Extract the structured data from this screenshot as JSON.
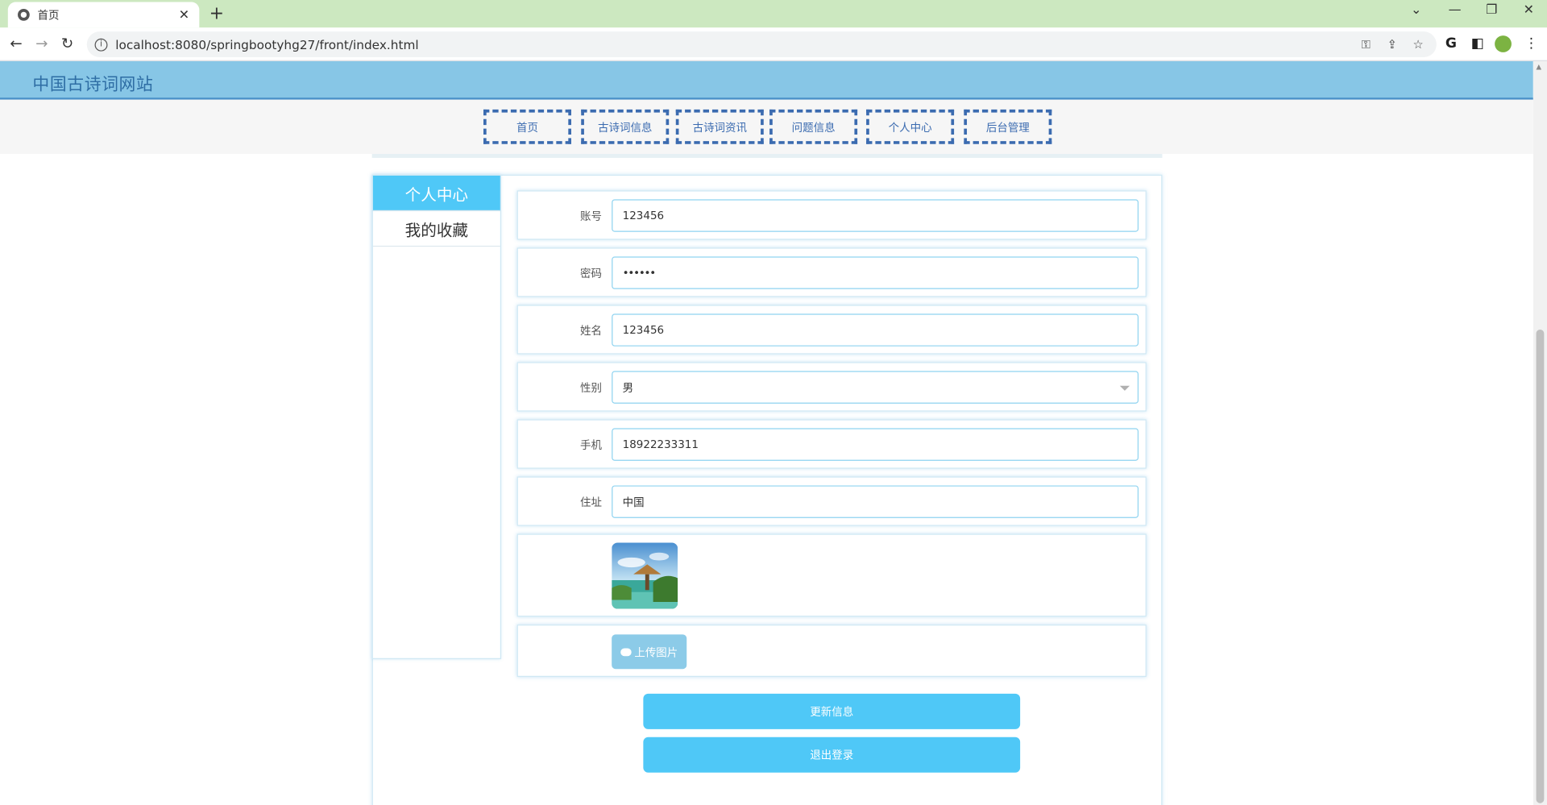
{
  "browser": {
    "tab_title": "首页",
    "tab_close": "✕",
    "new_tab": "+",
    "url": "localhost:8080/springbootyhg27/front/index.html",
    "back": "←",
    "forward": "→",
    "reload": "↻",
    "win_dropdown": "⌄",
    "win_minimize": "—",
    "win_restore": "❐",
    "win_close": "✕"
  },
  "site": {
    "title": "中国古诗词网站"
  },
  "nav": {
    "items": [
      "首页",
      "古诗词信息",
      "古诗词资讯",
      "问题信息",
      "个人中心",
      "后台管理"
    ]
  },
  "sidebar": {
    "items": [
      {
        "label": "个人中心",
        "active": true
      },
      {
        "label": "我的收藏",
        "active": false
      }
    ]
  },
  "form": {
    "account_label": "账号",
    "account_value": "123456",
    "password_label": "密码",
    "password_value": "••••••",
    "name_label": "姓名",
    "name_value": "123456",
    "gender_label": "性别",
    "gender_value": "男",
    "phone_label": "手机",
    "phone_value": "18922233311",
    "address_label": "住址",
    "address_value": "中国",
    "upload_label": "上传图片"
  },
  "actions": {
    "update": "更新信息",
    "logout": "退出登录"
  },
  "colors": {
    "header_bg": "#87c6e6",
    "accent": "#4fc8f7",
    "nav_border": "#3b6bb0",
    "tab_strip": "#cce8c0"
  }
}
